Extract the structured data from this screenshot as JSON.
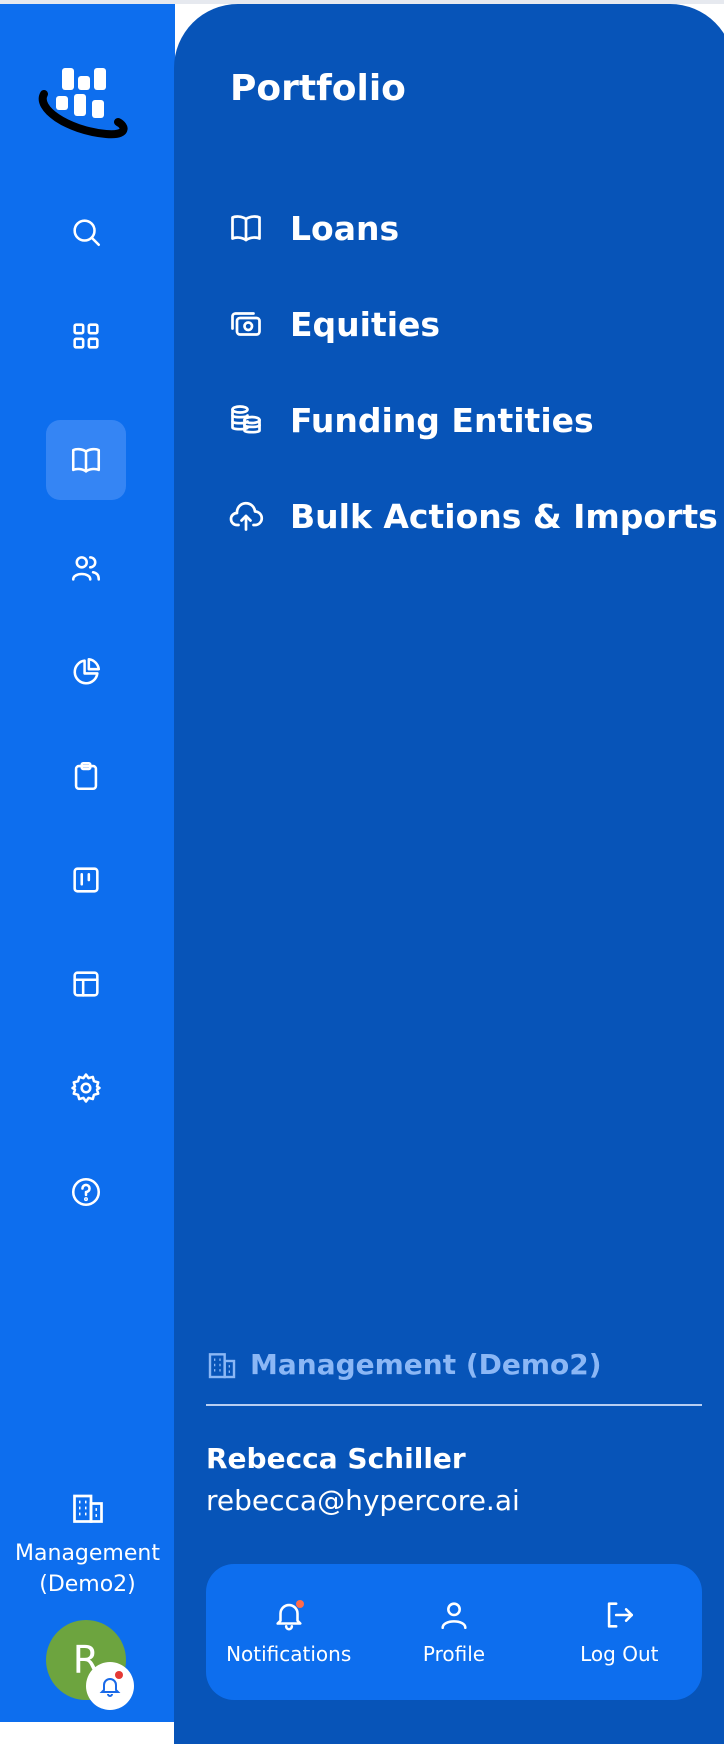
{
  "rail": {
    "logo_icon": "hypercore-logo",
    "items": [
      {
        "icon": "search-icon",
        "active": false
      },
      {
        "icon": "grid-icon",
        "active": false
      },
      {
        "icon": "book-icon",
        "active": true
      },
      {
        "icon": "users-icon",
        "active": false
      },
      {
        "icon": "pie-chart-icon",
        "active": false
      },
      {
        "icon": "clipboard-icon",
        "active": false
      },
      {
        "icon": "kanban-icon",
        "active": false
      },
      {
        "icon": "table-icon",
        "active": false
      },
      {
        "icon": "gear-icon",
        "active": false
      },
      {
        "icon": "help-icon",
        "active": false
      }
    ],
    "org_label": "Management (Demo2)",
    "avatar_initial": "R"
  },
  "panel": {
    "title": "Portfolio",
    "menu": [
      {
        "label": "Loans",
        "icon": "book-icon"
      },
      {
        "label": "Equities",
        "icon": "cash-icon"
      },
      {
        "label": "Funding Entities",
        "icon": "coins-icon"
      },
      {
        "label": "Bulk Actions & Imports",
        "icon": "cloud-upload-icon"
      }
    ],
    "org": "Management (Demo2)",
    "user": {
      "name": "Rebecca Schiller",
      "email": "rebecca@hypercore.ai"
    },
    "actions": [
      {
        "label": "Notifications",
        "icon": "bell-icon"
      },
      {
        "label": "Profile",
        "icon": "user-icon"
      },
      {
        "label": "Log Out",
        "icon": "logout-icon"
      }
    ]
  },
  "colors": {
    "rail_bg": "#0d6eee",
    "panel_bg": "#0754b8",
    "active_bg": "#3585f4",
    "org_text": "#8bb7f5",
    "avatar_bg": "#6da43f",
    "notification_dot": "#e53935"
  }
}
